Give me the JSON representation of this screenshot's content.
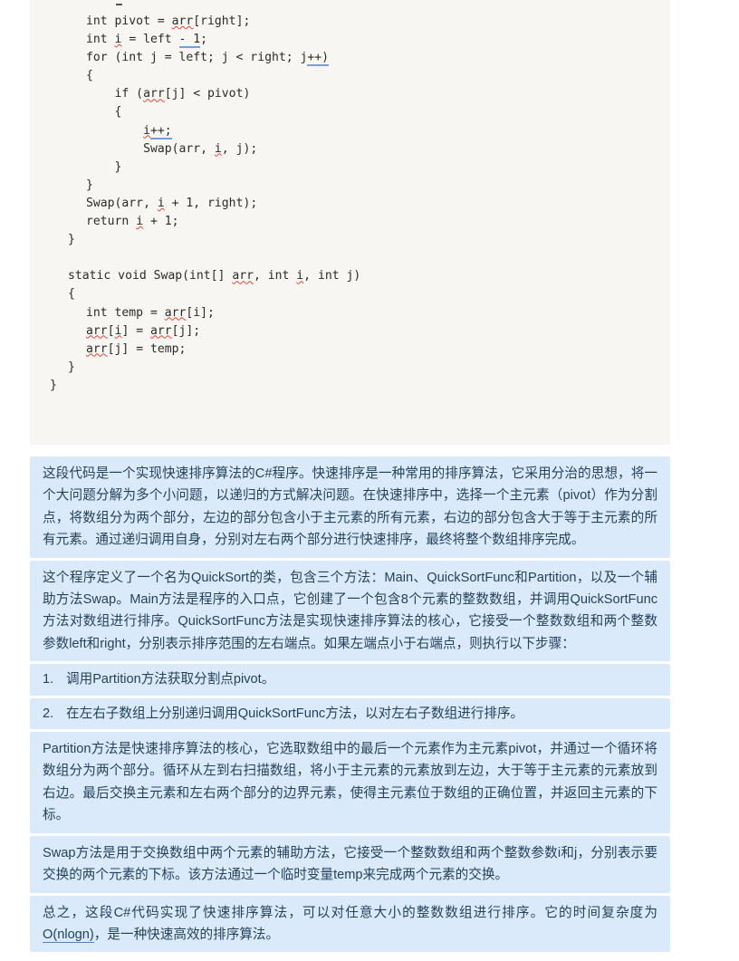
{
  "code": {
    "language": "csharp",
    "lines": [
      "        int pivot = arr[right];",
      "        int i = left - 1;",
      "        for (int j = left; j < right; j++)",
      "        {",
      "            if (arr[j] < pivot)",
      "            {",
      "                i++;",
      "                Swap(arr, i, j);",
      "            }",
      "        }",
      "        Swap(arr, i + 1, right);",
      "        return i + 1;",
      "    }",
      "",
      "    static void Swap(int[] arr, int i, int j)",
      "    {",
      "        int temp = arr[i];",
      "        arr[i] = arr[j];",
      "        arr[j] = temp;",
      "    }",
      "}"
    ]
  },
  "answer": {
    "paragraphs": [
      {
        "id": "p-overview",
        "text": "这段代码是一个实现快速排序算法的C#程序。快速排序是一种常用的排序算法，它采用分治的思想，将一个大问题分解为多个小问题，以递归的方式解决问题。在快速排序中，选择一个主元素（pivot）作为分割点，将数组分为两个部分，左边的部分包含小于主元素的所有元素，右边的部分包含大于等于主元素的所有元素。通过递归调用自身，分别对左右两个部分进行快速排序，最终将整个数组排序完成。"
      },
      {
        "id": "p-structure",
        "text": "这个程序定义了一个名为QuickSort的类，包含三个方法：Main、QuickSortFunc和Partition，以及一个辅助方法Swap。Main方法是程序的入口点，它创建了一个包含8个元素的整数数组，并调用QuickSortFunc方法对数组进行排序。QuickSortFunc方法是实现快速排序算法的核心，它接受一个整数数组和两个整数参数left和right，分别表示排序范围的左右端点。如果左端点小于右端点，则执行以下步骤："
      }
    ],
    "steps": [
      {
        "num": "1.",
        "text": "调用Partition方法获取分割点pivot。"
      },
      {
        "num": "2.",
        "text": "在左右子数组上分别递归调用QuickSortFunc方法，以对左右子数组进行排序。"
      }
    ],
    "paragraphs2": [
      {
        "id": "p-partition",
        "text": "Partition方法是快速排序算法的核心，它选取数组中的最后一个元素作为主元素pivot，并通过一个循环将数组分为两个部分。循环从左到右扫描数组，将小于主元素的元素放到左边，大于等于主元素的元素放到右边。最后交换主元素和左右两个部分的边界元素，使得主元素位于数组的正确位置，并返回主元素的下标。"
      },
      {
        "id": "p-swap",
        "text": "Swap方法是用于交换数组中两个元素的辅助方法，它接受一个整数数组和两个整数参数i和j，分别表示要交换的两个元素的下标。该方法通过一个临时变量temp来完成两个元素的交换。"
      }
    ],
    "conclusion": {
      "id": "p-conclusion",
      "prefix": "总之，这段C#代码实现了快速排序算法，可以对任意大小的整数数组进行排序。它的时间复杂度为",
      "complexity": "O(nlogn)",
      "suffix": "，是一种快速高效的排序算法。"
    }
  },
  "colors": {
    "code_background": "#f7f6f2",
    "answer_background": "#dbeafa",
    "answer_text": "#24425c",
    "code_text": "#2b2b2b",
    "spellcheck_underline": "#e0483a",
    "grammar_underline": "#7a9cd8"
  }
}
